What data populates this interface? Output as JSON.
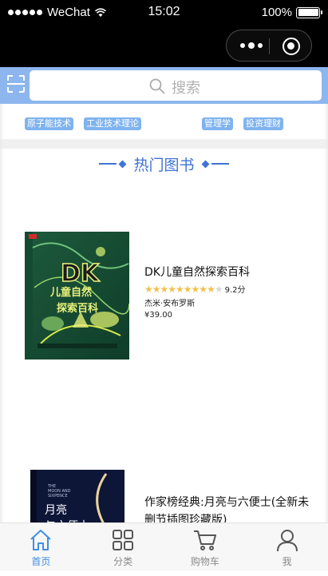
{
  "status_bar": {
    "carrier": "WeChat",
    "time": "15:02",
    "battery": "100%",
    "battery_level": 1.0
  },
  "nav": {
    "more_icon": "more-dots-icon",
    "close_icon": "target-close-icon"
  },
  "search": {
    "scan_icon": "scan-icon",
    "search_icon": "search-icon",
    "placeholder": "搜索"
  },
  "tags": [
    {
      "label": "原子能技术"
    },
    {
      "label": "工业技术理论"
    },
    {
      "label": "管理学"
    },
    {
      "label": "投资理财"
    }
  ],
  "section": {
    "title": "热门图书"
  },
  "books": [
    {
      "title": "DK儿童自然探索百科",
      "rating_stars": 4.6,
      "score": "9.2分",
      "author": "杰米·安布罗斯",
      "price": "¥39.00",
      "cover_text": "DK儿童自然探索百科",
      "cover_logo": "DK"
    },
    {
      "title": "作家榜经典:月亮与六便士(全新未删节插图珍藏版)",
      "cover_text": "月亮与六便士"
    }
  ],
  "tab_bar": {
    "tabs": [
      {
        "label": "首页",
        "icon": "home-icon",
        "active": true
      },
      {
        "label": "分类",
        "icon": "grid-icon",
        "active": false
      },
      {
        "label": "购物车",
        "icon": "cart-icon",
        "active": false
      },
      {
        "label": "我",
        "icon": "user-icon",
        "active": false
      }
    ]
  },
  "colors": {
    "accent": "#3f73d6",
    "search_band": "#8db6ee",
    "tag_bg": "#7fb3ef",
    "star": "#f2c14e",
    "tab_active": "#3f8ee6"
  }
}
